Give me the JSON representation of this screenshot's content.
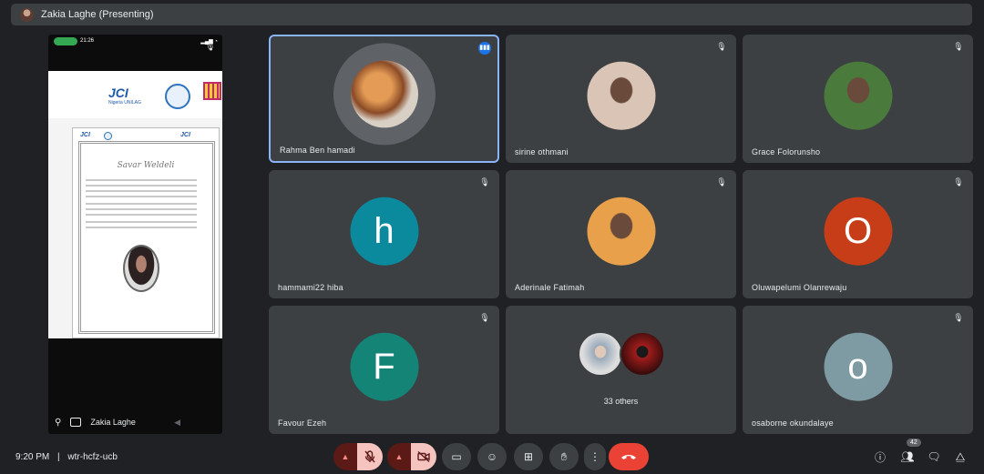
{
  "header": {
    "presenter": "Zakia Laghe (Presenting)"
  },
  "presentation": {
    "phone_time": "21:26",
    "name": "Zakia Laghe",
    "doc": {
      "org": "JCI",
      "org_sub": "Nigeria UNILAG",
      "cert_title": "Savar Weldeli"
    }
  },
  "tiles": [
    {
      "name": "Rahma Ben hamadi",
      "type": "ring",
      "active": true
    },
    {
      "name": "sirine othmani",
      "type": "photo",
      "color": "#d9c4b6"
    },
    {
      "name": "Grace Folorunsho",
      "type": "photo",
      "color": "#4a7a3c"
    },
    {
      "name": "hammami22 hiba",
      "type": "letter",
      "letter": "h",
      "color": "#0b8a9e"
    },
    {
      "name": "Aderinale Fatimah",
      "type": "photo",
      "color": "#e8a04a"
    },
    {
      "name": "Oluwapelumi Olanrewaju",
      "type": "letter",
      "letter": "O",
      "color": "#c63d17"
    },
    {
      "name": "Favour Ezeh",
      "type": "letter",
      "letter": "F",
      "color": "#148477"
    },
    {
      "name": "33 others",
      "type": "others"
    },
    {
      "name": "osaborne okundalaye",
      "type": "letter",
      "letter": "o",
      "color": "#7e9ba3"
    }
  ],
  "bottom": {
    "time": "9:20 PM",
    "separator": "|",
    "meeting_code": "wtr-hcfz-ucb",
    "people_count": "42"
  },
  "icons": {
    "mic_off": "mic-off-icon",
    "cam_off": "camera-off-icon",
    "hangup": "hangup-icon"
  }
}
